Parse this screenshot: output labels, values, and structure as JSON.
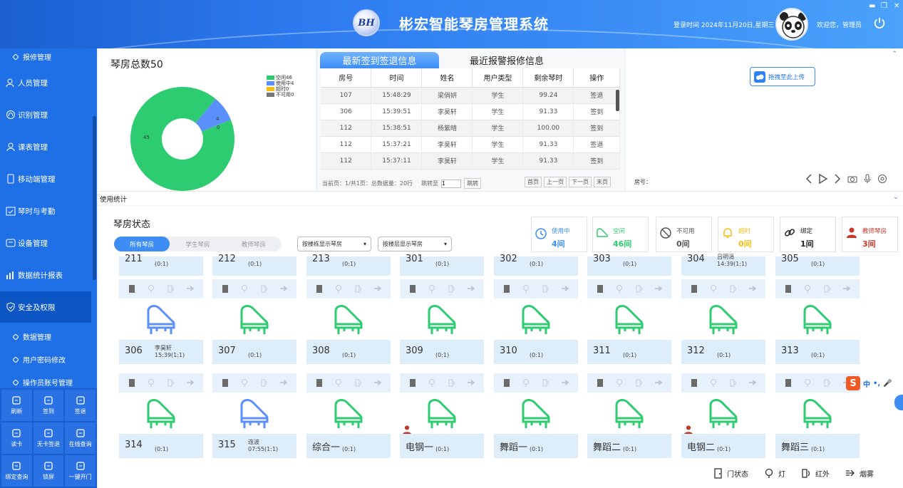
{
  "header": {
    "logo_text": "BH",
    "title": "彬宏智能琴房管理系统",
    "login_time": "登录时间 2024年11月20日,星期三",
    "welcome": "欢迎您，管理员"
  },
  "sidebar": {
    "top_sub": "报修管理",
    "items": [
      {
        "label": "人员管理",
        "icon": "user-group-icon"
      },
      {
        "label": "识别管理",
        "icon": "fingerprint-icon"
      },
      {
        "label": "课表管理",
        "icon": "person-icon"
      },
      {
        "label": "移动端管理",
        "icon": "mobile-icon"
      },
      {
        "label": "琴时与考勤",
        "icon": "calendar-check-icon"
      },
      {
        "label": "设备管理",
        "icon": "device-icon"
      },
      {
        "label": "数据统计报表",
        "icon": "bar-chart-icon"
      },
      {
        "label": "安全及权限",
        "icon": "shield-icon"
      }
    ],
    "sub_items": [
      "数据管理",
      "用户密码修改",
      "操作员账号管理"
    ]
  },
  "quick_actions": [
    {
      "label": "刷新",
      "icon": "refresh-icon"
    },
    {
      "label": "签到",
      "icon": "sign-in-icon"
    },
    {
      "label": "签退",
      "icon": "sign-out-icon"
    },
    {
      "label": "读卡",
      "icon": "card-reader-icon"
    },
    {
      "label": "无卡签退",
      "icon": "no-card-icon"
    },
    {
      "label": "在线查询",
      "icon": "online-query-icon"
    },
    {
      "label": "绑定查询",
      "icon": "bind-query-icon"
    },
    {
      "label": "锁屏",
      "icon": "lock-icon"
    },
    {
      "label": "一键开门",
      "icon": "door-icon"
    }
  ],
  "pie": {
    "title": "琴房总数50",
    "legend": [
      {
        "label": "空闲46",
        "color": "#2ecc71"
      },
      {
        "label": "使用中4",
        "color": "#5b8ff9"
      },
      {
        "label": "超时0",
        "color": "#f6bd16"
      },
      {
        "label": "不可用0",
        "color": "#777777"
      }
    ],
    "labels": {
      "free": "45",
      "in_use": "4",
      "over": "0"
    }
  },
  "chart_data": {
    "type": "pie",
    "title": "琴房总数50",
    "categories": [
      "空闲",
      "使用中",
      "超时",
      "不可用"
    ],
    "values": [
      46,
      4,
      0,
      0
    ],
    "colors": [
      "#2ecc71",
      "#5b8ff9",
      "#f6bd16",
      "#777777"
    ],
    "slice_labels": [
      "45",
      "4",
      "0",
      ""
    ],
    "legend_position": "right"
  },
  "sign": {
    "tab_active": "最新签到签退信息",
    "tab_inactive": "最近报警报修信息",
    "columns": [
      "房号",
      "时间",
      "姓名",
      "用户类型",
      "剩余琴时",
      "操作"
    ],
    "rows": [
      [
        "107",
        "15:48:29",
        "梁俏妍",
        "学生",
        "99.24",
        "签退"
      ],
      [
        "306",
        "15:39:51",
        "李昊轩",
        "学生",
        "91.33",
        "签到"
      ],
      [
        "112",
        "15:38:51",
        "杨紫晴",
        "学生",
        "100.00",
        "签到"
      ],
      [
        "112",
        "15:37:21",
        "李昊轩",
        "学生",
        "91.33",
        "签退"
      ],
      [
        "112",
        "15:37:11",
        "李昊轩",
        "学生",
        "91.33",
        "签到"
      ]
    ],
    "pager_info": "当前页：1/共1页：总数据量：20行",
    "jump_label": "跳转至",
    "jump_value": "1",
    "jump_btn": "跳转",
    "first": "首页",
    "prev": "上一页",
    "next": "下一页",
    "last": "末页"
  },
  "video": {
    "upload_label": "拖拽至此上传",
    "room_label": "房号："
  },
  "usage_label": "使用统计",
  "room_status": {
    "title": "琴房状态",
    "filters": [
      "所有琴房",
      "学生琴房",
      "教师琴房"
    ],
    "select1": "按楼栋显示琴房",
    "select2": "按楼层显示琴房",
    "stats": [
      {
        "label": "使用中",
        "value": "4间",
        "color": "#3d8df5",
        "icon": "clock-icon"
      },
      {
        "label": "空闲",
        "value": "46间",
        "color": "#2ecc71",
        "icon": "piano-icon"
      },
      {
        "label": "不可用",
        "value": "0间",
        "color": "#555555",
        "icon": "ban-icon"
      },
      {
        "label": "超时",
        "value": "0间",
        "color": "#f6bd16",
        "icon": "bell-icon"
      },
      {
        "label": "绑定",
        "value": "1间",
        "color": "#222222",
        "icon": "link-icon"
      },
      {
        "label": "教师琴房",
        "value": "3间",
        "color": "#c0392b",
        "icon": "teacher-icon"
      }
    ],
    "row0": [
      {
        "name": "211",
        "occ": "(0:1)"
      },
      {
        "name": "212",
        "occ": "(0:1)"
      },
      {
        "name": "213",
        "occ": "(0:1)"
      },
      {
        "name": "301",
        "occ": "(0:1)"
      },
      {
        "name": "302",
        "occ": "(0:1)"
      },
      {
        "name": "303",
        "occ": "(0:1)"
      },
      {
        "name": "304",
        "occ": "14:39(1:1)",
        "top": "吕明涓"
      },
      {
        "name": "305",
        "occ": "(0:1)"
      }
    ],
    "row1": [
      {
        "name": "306",
        "user": "李昊轩",
        "occ": "15:39(1:1)",
        "state": "in_use"
      },
      {
        "name": "307",
        "occ": "(0:1)",
        "state": "free"
      },
      {
        "name": "308",
        "occ": "(0:1)",
        "state": "free"
      },
      {
        "name": "309",
        "occ": "(0:1)",
        "state": "free"
      },
      {
        "name": "310",
        "occ": "(0:1)",
        "state": "free"
      },
      {
        "name": "311",
        "occ": "(0:1)",
        "state": "free"
      },
      {
        "name": "312",
        "occ": "(0:1)",
        "state": "free"
      },
      {
        "name": "313",
        "occ": "(0:1)",
        "state": "free"
      }
    ],
    "row2": [
      {
        "name": "314",
        "occ": "(0:1)",
        "state": "free"
      },
      {
        "name": "315",
        "user": "连波",
        "occ": "07:55(1:1)",
        "state": "in_use"
      },
      {
        "name": "综合一",
        "occ": "(0:1)",
        "state": "free"
      },
      {
        "name": "电钢一",
        "occ": "(0:1)",
        "state": "free",
        "teacher": true
      },
      {
        "name": "舞蹈一",
        "occ": "(0:1)",
        "state": "free"
      },
      {
        "name": "舞蹈二",
        "occ": "(0:1)",
        "state": "free"
      },
      {
        "name": "电钢二",
        "occ": "(0:1)",
        "state": "free",
        "teacher": true
      },
      {
        "name": "舞蹈三",
        "occ": "(0:1)",
        "state": "free"
      }
    ],
    "colors": {
      "free": "#2ecc71",
      "in_use": "#5b8ff9"
    }
  },
  "bottom_legend": [
    {
      "label": "门状态",
      "icon": "door-status-icon"
    },
    {
      "label": "灯",
      "icon": "light-icon"
    },
    {
      "label": "红外",
      "icon": "infrared-icon"
    },
    {
      "label": "烟雾",
      "icon": "smoke-icon"
    }
  ],
  "ime": {
    "badge": "S",
    "text": "中"
  }
}
